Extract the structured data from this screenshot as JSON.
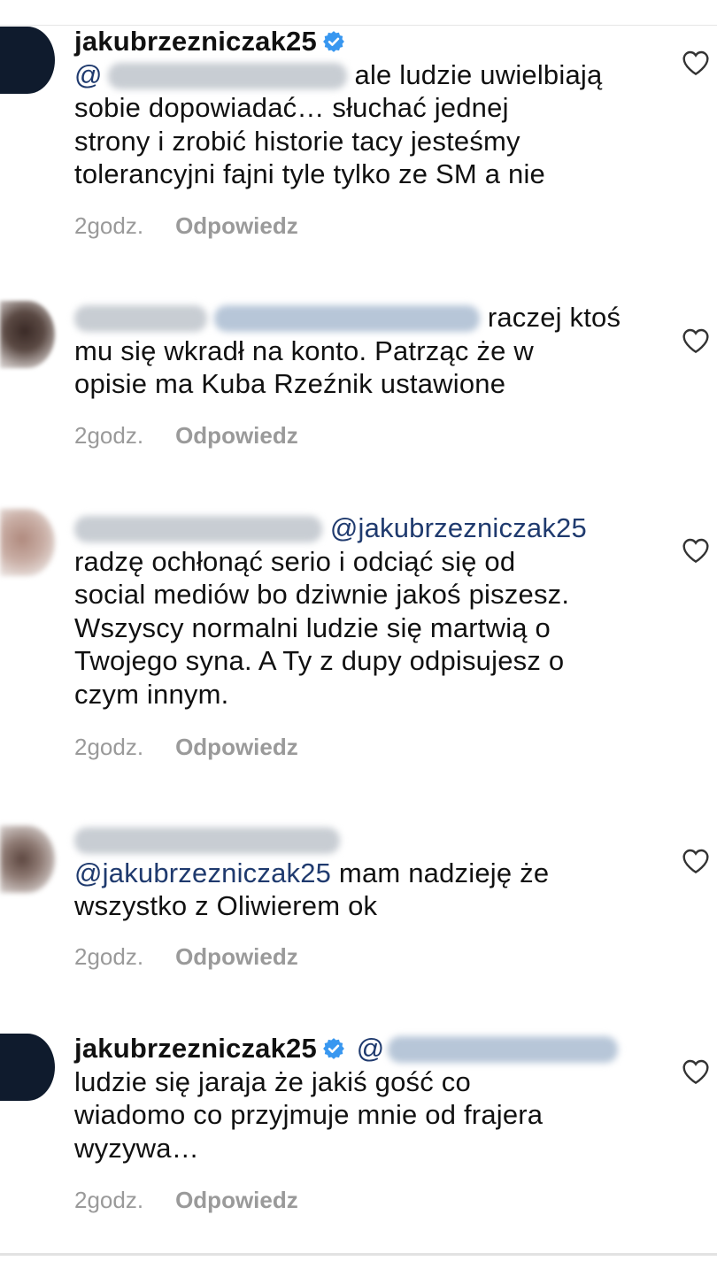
{
  "comments": [
    {
      "username": "jakubrzezniczak25",
      "verified": true,
      "mention_prefix": "@",
      "text_lines": [
        "ale ludzie uwielbiają",
        "sobie dopowiadać… słuchać jednej",
        "strony i zrobić historie tacy jesteśmy",
        "tolerancyjni fajni tyle tylko ze SM a nie"
      ],
      "time": "2godz.",
      "reply_label": "Odpowiedz"
    },
    {
      "text_lines": [
        "raczej ktoś",
        "mu się wkradł na konto. Patrząc że w",
        "opisie ma Kuba Rzeźnik ustawione"
      ],
      "time": "2godz.",
      "reply_label": "Odpowiedz"
    },
    {
      "mention": "@jakubrzezniczak25",
      "text_lines": [
        "radzę ochłonąć serio i odciąć się od",
        "social mediów bo dziwnie jakoś piszesz.",
        "Wszyscy normalni ludzie się martwią o",
        "Twojego syna. A Ty z dupy odpisujesz o",
        "czym innym."
      ],
      "time": "2godz.",
      "reply_label": "Odpowiedz"
    },
    {
      "mention": "@jakubrzezniczak25",
      "text_after_mention": "mam nadzieję że",
      "text_lines": [
        "wszystko z Oliwierem ok"
      ],
      "time": "2godz.",
      "reply_label": "Odpowiedz"
    },
    {
      "username": "jakubrzezniczak25",
      "verified": true,
      "mention_prefix": "@",
      "text_lines": [
        "ludzie się jaraja że jakiś gość co",
        "wiadomo co przyjmuje mnie od frajera",
        "wyzywa…"
      ],
      "time": "2godz.",
      "reply_label": "Odpowiedz"
    }
  ],
  "icons": {
    "verified": "verified-badge-icon",
    "like": "heart-outline-icon"
  },
  "colors": {
    "mention": "#1f3a6e",
    "verified": "#3897f0",
    "meta": "#9a9a9a"
  }
}
